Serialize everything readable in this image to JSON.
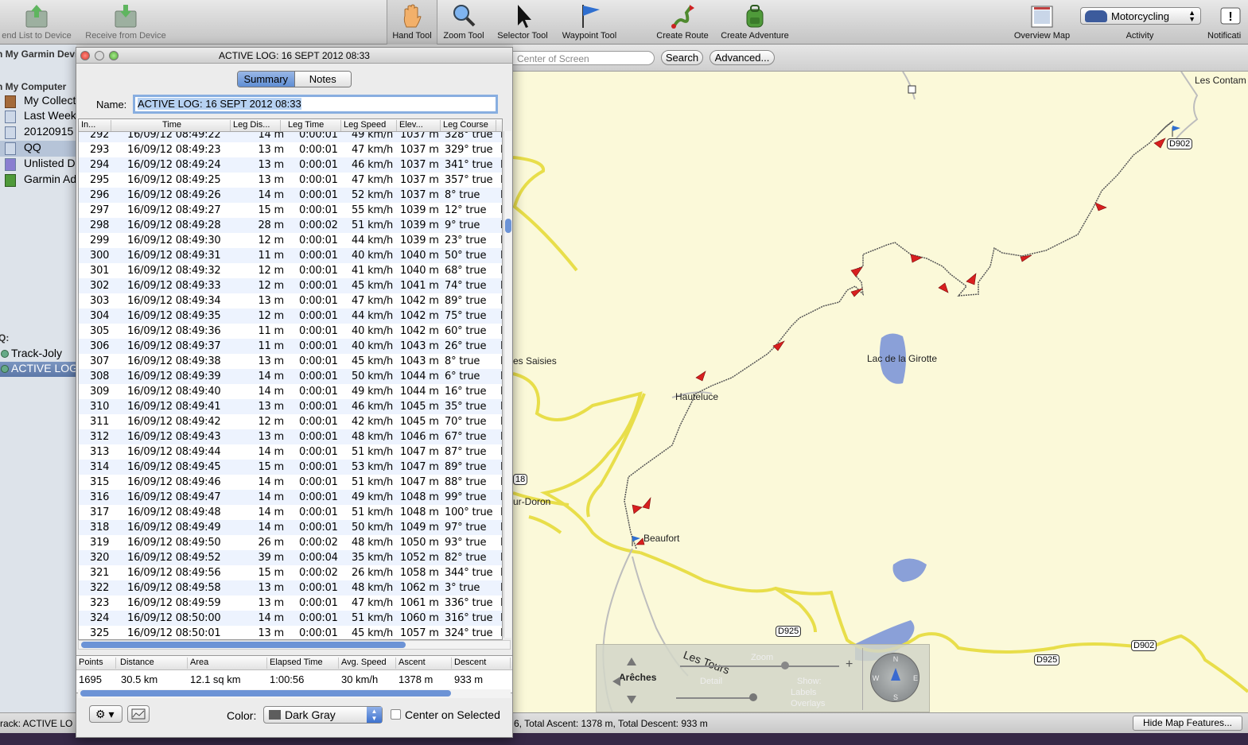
{
  "toolbar": {
    "send": "end List to Device",
    "receive": "Receive from Device",
    "hand": "Hand Tool",
    "zoom": "Zoom Tool",
    "selector": "Selector Tool",
    "waypoint": "Waypoint Tool",
    "create_route": "Create Route",
    "create_adventure": "Create Adventure",
    "overview": "Overview Map",
    "activity_value": "Motorcycling",
    "activity_label": "Activity",
    "notif": "Notificati"
  },
  "sidebar": {
    "device_header": "n My Garmin Device",
    "computer_header": "n My Computer",
    "items": [
      "My Collecti",
      "Last Week",
      "20120915",
      "QQ",
      "Unlisted D",
      "Garmin Ad"
    ],
    "qq_header": "Q:",
    "qq_items": [
      "Track-Joly",
      "ACTIVE LOG:"
    ]
  },
  "searchbar": {
    "placeholder": "Center of Screen",
    "search_btn": "Search",
    "advanced_btn": "Advanced..."
  },
  "map": {
    "labels": {
      "contam": "Les Contam",
      "girotte": "Lac de la Girotte",
      "saisies": "es Saisies",
      "hauteluce": "Hauteluce",
      "doron": "ur-Doron",
      "beaufort": "Beaufort",
      "arches": "Arêches",
      "tours": "Les Tours"
    },
    "shields": {
      "d902a": "D902",
      "d902b": "D902",
      "d925a": "D925",
      "d925b": "D925",
      "r18": "18"
    },
    "controls": {
      "zoom": "Zoom",
      "detail": "Detail",
      "show": "Show:",
      "labels": "Labels",
      "overlays": "Overlays"
    }
  },
  "window": {
    "title": "ACTIVE LOG: 16 SEPT 2012 08:33",
    "tab_summary": "Summary",
    "tab_notes": "Notes",
    "name_label": "Name:",
    "name_value": "ACTIVE LOG: 16 SEPT 2012 08:33",
    "columns": [
      "In...",
      "Time",
      "Leg Dis...",
      "Leg Time",
      "Leg Speed",
      "Elev...",
      "Leg Course"
    ],
    "rows": [
      [
        "292",
        "16/09/12 08:49:22",
        "14 m",
        "0:00:01",
        "49 km/h",
        "1037 m",
        "328° true",
        "N"
      ],
      [
        "293",
        "16/09/12 08:49:23",
        "13 m",
        "0:00:01",
        "47 km/h",
        "1037 m",
        "329° true",
        "N"
      ],
      [
        "294",
        "16/09/12 08:49:24",
        "13 m",
        "0:00:01",
        "46 km/h",
        "1037 m",
        "341° true",
        "N"
      ],
      [
        "295",
        "16/09/12 08:49:25",
        "13 m",
        "0:00:01",
        "47 km/h",
        "1037 m",
        "357° true",
        "N"
      ],
      [
        "296",
        "16/09/12 08:49:26",
        "14 m",
        "0:00:01",
        "52 km/h",
        "1037 m",
        "8° true",
        "N"
      ],
      [
        "297",
        "16/09/12 08:49:27",
        "15 m",
        "0:00:01",
        "55 km/h",
        "1039 m",
        "12° true",
        "N"
      ],
      [
        "298",
        "16/09/12 08:49:28",
        "28 m",
        "0:00:02",
        "51 km/h",
        "1039 m",
        "9° true",
        "N"
      ],
      [
        "299",
        "16/09/12 08:49:30",
        "12 m",
        "0:00:01",
        "44 km/h",
        "1039 m",
        "23° true",
        "N"
      ],
      [
        "300",
        "16/09/12 08:49:31",
        "11 m",
        "0:00:01",
        "40 km/h",
        "1040 m",
        "50° true",
        "N"
      ],
      [
        "301",
        "16/09/12 08:49:32",
        "12 m",
        "0:00:01",
        "41 km/h",
        "1040 m",
        "68° true",
        "N"
      ],
      [
        "302",
        "16/09/12 08:49:33",
        "12 m",
        "0:00:01",
        "45 km/h",
        "1041 m",
        "74° true",
        "N"
      ],
      [
        "303",
        "16/09/12 08:49:34",
        "13 m",
        "0:00:01",
        "47 km/h",
        "1042 m",
        "89° true",
        "N"
      ],
      [
        "304",
        "16/09/12 08:49:35",
        "12 m",
        "0:00:01",
        "44 km/h",
        "1042 m",
        "75° true",
        "N"
      ],
      [
        "305",
        "16/09/12 08:49:36",
        "11 m",
        "0:00:01",
        "40 km/h",
        "1042 m",
        "60° true",
        "N"
      ],
      [
        "306",
        "16/09/12 08:49:37",
        "11 m",
        "0:00:01",
        "40 km/h",
        "1043 m",
        "26° true",
        "N"
      ],
      [
        "307",
        "16/09/12 08:49:38",
        "13 m",
        "0:00:01",
        "45 km/h",
        "1043 m",
        "8° true",
        "N"
      ],
      [
        "308",
        "16/09/12 08:49:39",
        "14 m",
        "0:00:01",
        "50 km/h",
        "1044 m",
        "6° true",
        "N"
      ],
      [
        "309",
        "16/09/12 08:49:40",
        "14 m",
        "0:00:01",
        "49 km/h",
        "1044 m",
        "16° true",
        "N"
      ],
      [
        "310",
        "16/09/12 08:49:41",
        "13 m",
        "0:00:01",
        "46 km/h",
        "1045 m",
        "35° true",
        "N"
      ],
      [
        "311",
        "16/09/12 08:49:42",
        "12 m",
        "0:00:01",
        "42 km/h",
        "1045 m",
        "70° true",
        "N"
      ],
      [
        "312",
        "16/09/12 08:49:43",
        "13 m",
        "0:00:01",
        "48 km/h",
        "1046 m",
        "67° true",
        "N"
      ],
      [
        "313",
        "16/09/12 08:49:44",
        "14 m",
        "0:00:01",
        "51 km/h",
        "1047 m",
        "87° true",
        "N"
      ],
      [
        "314",
        "16/09/12 08:49:45",
        "15 m",
        "0:00:01",
        "53 km/h",
        "1047 m",
        "89° true",
        "N"
      ],
      [
        "315",
        "16/09/12 08:49:46",
        "14 m",
        "0:00:01",
        "51 km/h",
        "1047 m",
        "88° true",
        "N"
      ],
      [
        "316",
        "16/09/12 08:49:47",
        "14 m",
        "0:00:01",
        "49 km/h",
        "1048 m",
        "99° true",
        "N"
      ],
      [
        "317",
        "16/09/12 08:49:48",
        "14 m",
        "0:00:01",
        "51 km/h",
        "1048 m",
        "100° true",
        "N"
      ],
      [
        "318",
        "16/09/12 08:49:49",
        "14 m",
        "0:00:01",
        "50 km/h",
        "1049 m",
        "97° true",
        "N"
      ],
      [
        "319",
        "16/09/12 08:49:50",
        "26 m",
        "0:00:02",
        "48 km/h",
        "1050 m",
        "93° true",
        "N"
      ],
      [
        "320",
        "16/09/12 08:49:52",
        "39 m",
        "0:00:04",
        "35 km/h",
        "1052 m",
        "82° true",
        "N"
      ],
      [
        "321",
        "16/09/12 08:49:56",
        "15 m",
        "0:00:02",
        "26 km/h",
        "1058 m",
        "344° true",
        "N"
      ],
      [
        "322",
        "16/09/12 08:49:58",
        "13 m",
        "0:00:01",
        "48 km/h",
        "1062 m",
        "3° true",
        "N"
      ],
      [
        "323",
        "16/09/12 08:49:59",
        "13 m",
        "0:00:01",
        "47 km/h",
        "1061 m",
        "336° true",
        "N"
      ],
      [
        "324",
        "16/09/12 08:50:00",
        "14 m",
        "0:00:01",
        "51 km/h",
        "1060 m",
        "316° true",
        "N"
      ],
      [
        "325",
        "16/09/12 08:50:01",
        "13 m",
        "0:00:01",
        "45 km/h",
        "1057 m",
        "324° true",
        "N"
      ]
    ],
    "summary_headers": [
      "Points",
      "Distance",
      "Area",
      "Elapsed Time",
      "Avg. Speed",
      "Ascent",
      "Descent"
    ],
    "summary_values": [
      "1695",
      "30.5 km",
      "12.1 sq km",
      "1:00:56",
      "30 km/h",
      "1378 m",
      "933 m"
    ],
    "color_label": "Color:",
    "color_value": "Dark Gray",
    "center_label": "Center on Selected"
  },
  "status": {
    "left": "rack: ACTIVE LO",
    "right": "6, Total Ascent: 1378 m, Total Descent: 933 m",
    "hide_btn": "Hide Map Features..."
  }
}
